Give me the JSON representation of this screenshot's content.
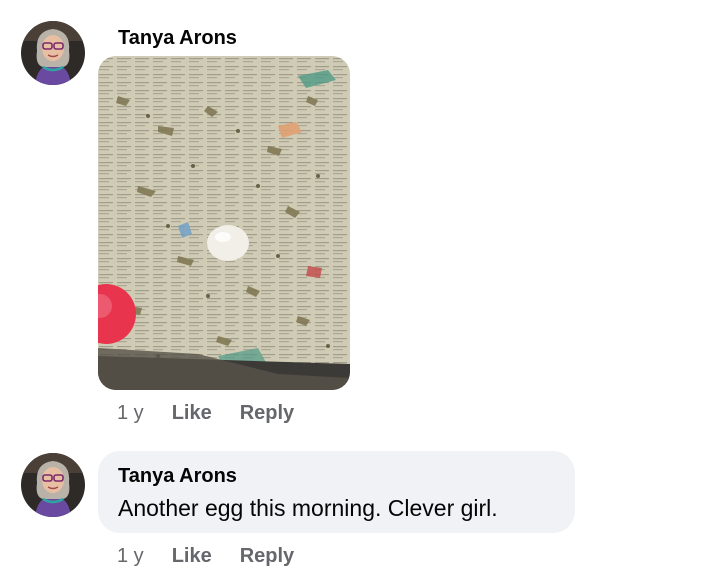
{
  "comments": [
    {
      "author": "Tanya Arons",
      "has_photo": true,
      "time": "1 y",
      "like_label": "Like",
      "reply_label": "Reply"
    },
    {
      "author": "Tanya Arons",
      "text": "Another egg this morning.  Clever girl.",
      "time": "1 y",
      "like_label": "Like",
      "reply_label": "Reply"
    }
  ],
  "colors": {
    "meta_text": "#65676b",
    "bubble_bg": "#f0f2f5",
    "name_text": "#050505"
  }
}
